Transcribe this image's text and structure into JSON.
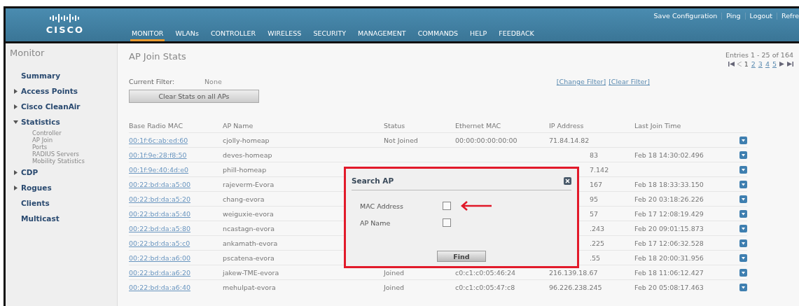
{
  "header": {
    "logo": "CISCO",
    "nav": [
      {
        "label": "MONITOR",
        "selected": true
      },
      {
        "label": "WLANs",
        "selected": false
      },
      {
        "label": "CONTROLLER",
        "selected": false
      },
      {
        "label": "WIRELESS",
        "selected": false
      },
      {
        "label": "SECURITY",
        "selected": false
      },
      {
        "label": "MANAGEMENT",
        "selected": false
      },
      {
        "label": "COMMANDS",
        "selected": false
      },
      {
        "label": "HELP",
        "selected": false
      },
      {
        "label": "FEEDBACK",
        "selected": false
      }
    ],
    "links": [
      "Save Configuration",
      "Ping",
      "Logout",
      "Refre"
    ]
  },
  "sidebar": {
    "title": "Monitor",
    "items": [
      {
        "label": "Summary",
        "kind": "link"
      },
      {
        "label": "Access Points",
        "kind": "folder",
        "expanded": false
      },
      {
        "label": "Cisco CleanAir",
        "kind": "folder",
        "expanded": false
      },
      {
        "label": "Statistics",
        "kind": "folder",
        "expanded": true,
        "children": [
          {
            "label": "Controller"
          },
          {
            "label": "AP Join"
          },
          {
            "label": "Ports"
          },
          {
            "label": "RADIUS Servers"
          },
          {
            "label": "Mobility Statistics"
          }
        ]
      },
      {
        "label": "CDP",
        "kind": "folder",
        "expanded": false
      },
      {
        "label": "Rogues",
        "kind": "folder",
        "expanded": false
      },
      {
        "label": "Clients",
        "kind": "link"
      },
      {
        "label": "Multicast",
        "kind": "link"
      }
    ]
  },
  "page": {
    "title": "AP Join Stats",
    "entries": "Entries 1 - 25 of 164",
    "pages": [
      {
        "label": "1",
        "selected": true
      },
      {
        "label": "2",
        "selected": false
      },
      {
        "label": "3",
        "selected": false
      },
      {
        "label": "4",
        "selected": false
      },
      {
        "label": "5",
        "selected": false
      }
    ],
    "filter_label": "Current Filter:",
    "filter_value": "None",
    "filter_links": [
      "[Change Filter]",
      "[Clear Filter]"
    ],
    "clear_button": "Clear Stats on all APs"
  },
  "table": {
    "columns": [
      "Base Radio MAC",
      "AP Name",
      "Status",
      "Ethernet MAC",
      "IP Address",
      "Last Join Time"
    ],
    "rows": [
      {
        "mac": "00:1f:6c:ab:ed:60",
        "name": "cjolly-homeap",
        "status": "Not Joined",
        "eth": "00:00:00:00:00:00",
        "ip": "71.84.14.82"
      },
      {
        "mac": "00:1f:9e:28:f8:50",
        "name": "deves-homeap",
        "ip": "83",
        "time": "Feb 18 14:30:02.496"
      },
      {
        "mac": "00:1f:9e:40:4d:e0",
        "name": "phill-homeap",
        "ip": "7.142"
      },
      {
        "mac": "00:22:bd:da:a5:00",
        "name": "rajeverm-Evora",
        "ip": "167",
        "time": "Feb 18 18:33:33.150"
      },
      {
        "mac": "00:22:bd:da:a5:20",
        "name": "chang-evora",
        "ip": "95",
        "time": "Feb 20 03:18:26.226"
      },
      {
        "mac": "00:22:bd:da:a5:40",
        "name": "weiguxie-evora",
        "ip": "57",
        "time": "Feb 17 12:08:19.429"
      },
      {
        "mac": "00:22:bd:da:a5:80",
        "name": "ncastagn-evora",
        "ip": ".243",
        "time": "Feb 20 09:01:15.873"
      },
      {
        "mac": "00:22:bd:da:a5:c0",
        "name": "ankamath-evora",
        "ip": ".225",
        "time": "Feb 17 12:06:32.528"
      },
      {
        "mac": "00:22:bd:da:a6:00",
        "name": "pscatena-evora",
        "ip": ".55",
        "time": "Feb 18 20:00:31.956"
      },
      {
        "mac": "00:22:bd:da:a6:20",
        "name": "jakew-TME-evora",
        "status": "Joined",
        "eth": "c0:c1:c0:05:46:24",
        "ip": "216.139.18.67",
        "time": "Feb 18 11:06:12.427"
      },
      {
        "mac": "00:22:bd:da:a6:40",
        "name": "mehulpat-evora",
        "status": "Joined",
        "eth": "c0:c1:c0:05:47:c8",
        "ip": "96.226.238.245",
        "time": "Feb 20 05:08:17.463"
      }
    ]
  },
  "dialog": {
    "title": "Search AP",
    "options": [
      {
        "label": "MAC Address",
        "checked": false,
        "pointer": true
      },
      {
        "label": "AP Name",
        "checked": false,
        "pointer": false
      }
    ],
    "button": "Find"
  }
}
